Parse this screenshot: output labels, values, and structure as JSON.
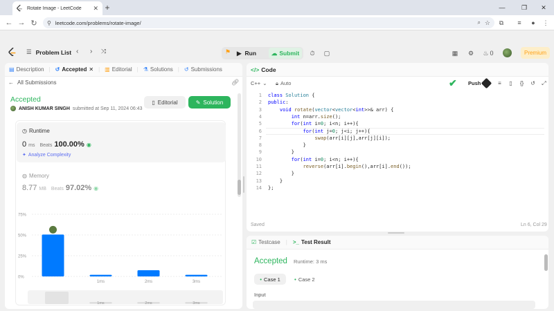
{
  "browser": {
    "tab_title": "Rotate Image - LeetCode",
    "url": "leetcode.com/problems/rotate-image/"
  },
  "nav": {
    "problem_list": "Problem List",
    "run": "Run",
    "submit": "Submit",
    "streak": "0",
    "premium": "Premium"
  },
  "left_tabs": [
    {
      "label": "Description",
      "icon": "description-icon"
    },
    {
      "label": "Accepted",
      "icon": "history-icon"
    },
    {
      "label": "Editorial",
      "icon": "book-icon"
    },
    {
      "label": "Solutions",
      "icon": "flask-icon"
    },
    {
      "label": "Submissions",
      "icon": "history-icon"
    }
  ],
  "submission": {
    "back": "All Submissions",
    "status": "Accepted",
    "user": "ANISH KUMAR SINGH",
    "submitted_at": "submitted at Sep 11, 2024 06:43",
    "editorial_btn": "Editorial",
    "solution_btn": "Solution",
    "runtime_label": "Runtime",
    "runtime_value": "0",
    "runtime_unit": "ms",
    "beats_label": "Beats",
    "runtime_beats": "100.00%",
    "analyze": "Analyze Complexity",
    "memory_label": "Memory",
    "memory_value": "8.77",
    "memory_unit": "MB",
    "memory_beats": "97.02%"
  },
  "chart_data": {
    "type": "bar",
    "categories": [
      "",
      "1ms",
      "2ms",
      "3ms"
    ],
    "values": [
      50.5,
      2,
      7.5,
      2
    ],
    "ylim": [
      0,
      75
    ],
    "yticks": [
      "75%",
      "50%",
      "25%",
      "0%"
    ],
    "highlight": "user bar at first category"
  },
  "code": {
    "title": "Code",
    "language": "C++",
    "mode": "Auto",
    "push": "Push",
    "saved": "Saved",
    "cursor": "Ln 6, Col 29",
    "lines": [
      "class Solution {",
      "public:",
      "    void rotate(vector<vector<int>>& arr) {",
      "        int n=arr.size();",
      "        for(int i=0; i<n; i++){",
      "            for(int j=0; j<i; j++){",
      "                swap(arr[i][j],arr[j][i]);",
      "            }",
      "        }",
      "        for(int i=0; i<n; i++){",
      "            reverse(arr[i].begin(),arr[i].end());",
      "        }",
      "    }",
      "};"
    ]
  },
  "result": {
    "testcase_tab": "Testcase",
    "result_tab": "Test Result",
    "status": "Accepted",
    "runtime": "Runtime: 3 ms",
    "case1": "Case 1",
    "case2": "Case 2",
    "input_label": "Input"
  },
  "colors": {
    "accent_green": "#2db55d",
    "bar_blue": "#007aff",
    "leetcode_orange": "#ffa116"
  }
}
